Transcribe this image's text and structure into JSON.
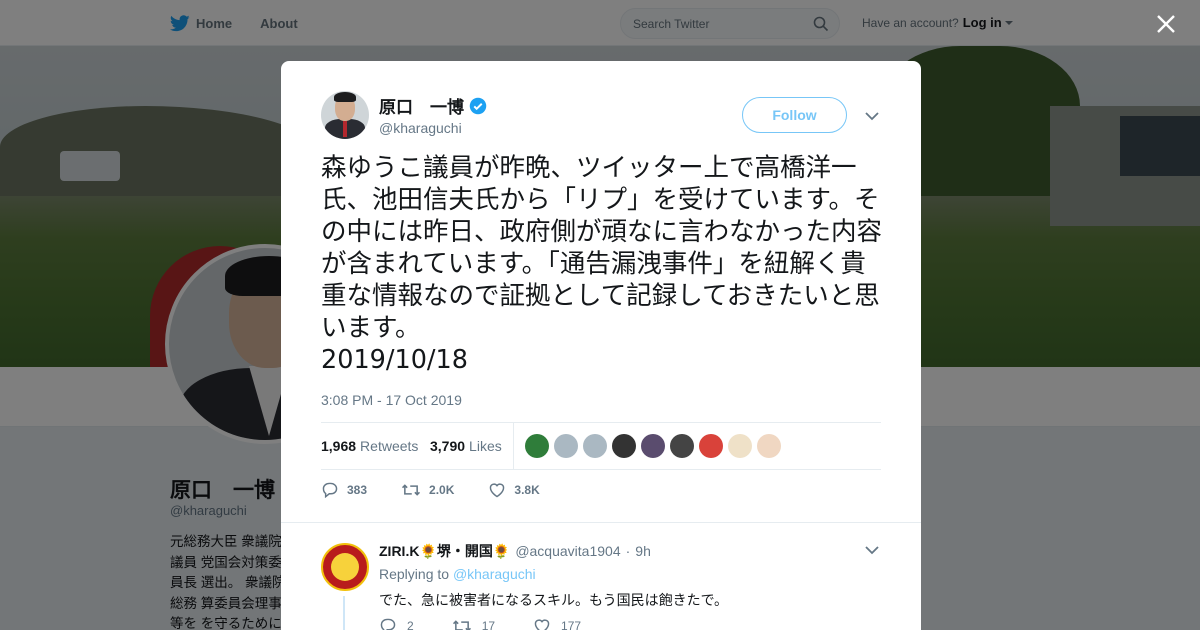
{
  "nav": {
    "home_label": "Home",
    "about_label": "About",
    "search_placeholder": "Search Twitter",
    "have_account": "Have an account?",
    "login_label": "Log in"
  },
  "profile": {
    "name": "原口　一博",
    "handle": "@kharaguchi",
    "bio": "元総務大臣 衆議院議員 党国会対策委員長 選出。 衆議院総務 算委員会理事等を を守るために行動"
  },
  "tweet": {
    "author_name": "原口　一博",
    "author_handle": "@kharaguchi",
    "follow_label": "Follow",
    "text": "森ゆうこ議員が昨晩、ツイッター上で高橋洋一氏、池田信夫氏から「リプ」を受けています。その中には昨日、政府側が頑なに言わなかった内容が含まれています。「通告漏洩事件」を紐解く貴重な情報なので証拠として記録しておきたいと思います。\n2019/10/18",
    "timestamp": "3:08 PM - 17 Oct 2019",
    "retweets_count": "1,968",
    "retweets_label": "Retweets",
    "likes_count": "3,790",
    "likes_label": "Likes",
    "reply_count": "383",
    "retweet_count_short": "2.0K",
    "like_count_short": "3.8K",
    "liker_colors": [
      "#2f7d3a",
      "#aab8c2",
      "#aab8c2",
      "#333333",
      "#5a4c6e",
      "#444444",
      "#d9423a",
      "#efe1c8",
      "#f0d7c2"
    ]
  },
  "reply": {
    "name": "ZIRI.K🌻堺・開国🌻",
    "handle": "@acquavita1904",
    "time": "9h",
    "replying_to_label": "Replying to",
    "replying_to_handle": "@kharaguchi",
    "text": "でた、急に被害者になるスキル。もう国民は飽きたで。",
    "reply_count": "2",
    "retweet_count": "17",
    "like_count": "177"
  },
  "colors": {
    "accent": "#1da1f2",
    "text": "#14171a",
    "muted": "#657786"
  }
}
